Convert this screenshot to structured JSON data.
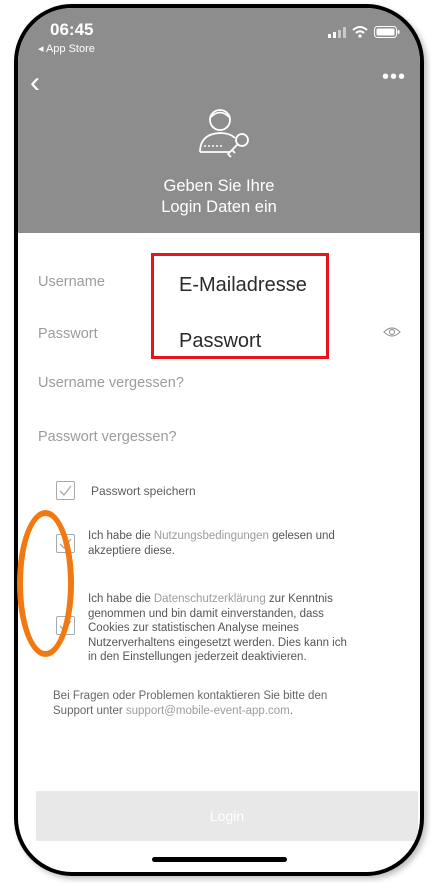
{
  "status": {
    "time": "06:45",
    "back_app": "◂ App Store"
  },
  "nav": {
    "back": "‹",
    "more": "•••"
  },
  "header": {
    "title_line1": "Geben Sie Ihre",
    "title_line2": "Login Daten ein"
  },
  "form": {
    "username_label": "Username",
    "password_label": "Passwort",
    "username_placeholder": "E-Mailadresse",
    "password_placeholder": "Passwort",
    "forgot_username": "Username vergessen?",
    "forgot_password": "Passwort vergessen?"
  },
  "checkboxes": {
    "save_password": "Passwort speichern",
    "terms_prefix": "Ich habe die ",
    "terms_link": "Nutzungsbedingungen",
    "terms_mid": " gelesen und",
    "terms_line2": "akzeptiere diese.",
    "privacy_prefix": "Ich habe die ",
    "privacy_link": "Datenschutzerklärung",
    "privacy_rest": " zur Kenntnis",
    "privacy_line2": "genommen und bin damit einverstanden, dass",
    "privacy_line3": "Cookies zur statistischen Analyse meines",
    "privacy_line4": "Nutzerverhaltens eingesetzt werden. Dies kann ich",
    "privacy_line5": "in den Einstellungen jederzeit deaktivieren."
  },
  "support": {
    "line1": "Bei Fragen oder Problemen kontaktieren Sie bitte den",
    "line2_prefix": "Support unter ",
    "email": "support@mobile-event-app.com",
    "line2_suffix": "."
  },
  "login_button": "Login",
  "colors": {
    "header_bg": "#8d8d8d",
    "highlight_box": "#e8141c",
    "annotation_ring": "#f27811"
  }
}
